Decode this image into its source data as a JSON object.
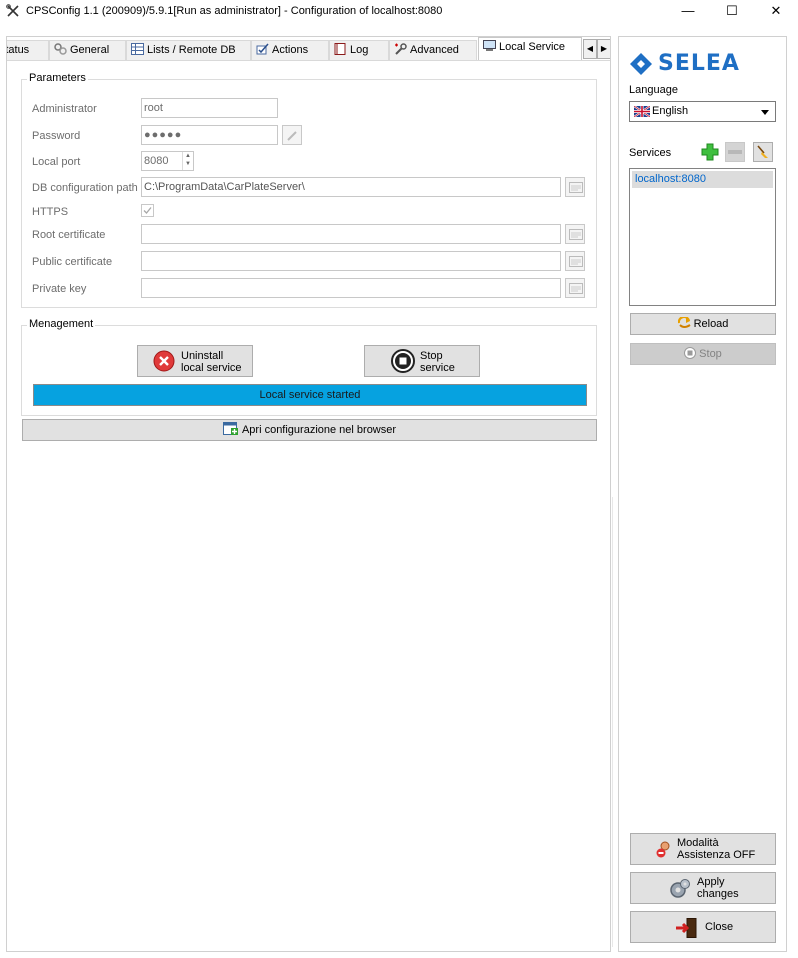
{
  "window": {
    "title": "CPSConfig 1.1 (200909)/5.9.1[Run as administrator] - Configuration of localhost:8080",
    "minimize": "—",
    "maximize": "☐",
    "close": "✕"
  },
  "tabs": [
    {
      "label": "Status",
      "icon": "status-icon"
    },
    {
      "label": "General",
      "icon": "gears-icon"
    },
    {
      "label": "Lists / Remote DB",
      "icon": "table-icon"
    },
    {
      "label": "Actions",
      "icon": "actions-icon"
    },
    {
      "label": "Log",
      "icon": "book-icon"
    },
    {
      "label": "Advanced",
      "icon": "wrench-icon"
    },
    {
      "label": "Local Service",
      "icon": "computer-icon",
      "active": true
    }
  ],
  "parameters": {
    "title": "Parameters",
    "administrator": {
      "label": "Administrator",
      "value": "root"
    },
    "password": {
      "label": "Password",
      "value": "●●●●●"
    },
    "local_port": {
      "label": "Local port",
      "value": "8080"
    },
    "db_path": {
      "label": "DB configuration path",
      "value": "C:\\ProgramData\\CarPlateServer\\"
    },
    "https": {
      "label": "HTTPS",
      "checked": true
    },
    "root_cert": {
      "label": "Root certificate",
      "value": ""
    },
    "public_cert": {
      "label": "Public certificate",
      "value": ""
    },
    "private_key": {
      "label": "Private key",
      "value": ""
    }
  },
  "management": {
    "title": "Menagement",
    "uninstall": {
      "line1": "Uninstall",
      "line2": "local service"
    },
    "stop": {
      "line1": "Stop",
      "line2": "service"
    },
    "status": "Local service started",
    "status_color": "#06a2e0"
  },
  "open_browser": "Apri configurazione nel browser",
  "sidebar": {
    "brand": "SELEA",
    "brand_color": "#1f6fc4",
    "language_label": "Language",
    "language_value": "English",
    "services_label": "Services",
    "services": [
      "localhost:8080"
    ],
    "reload": "Reload",
    "stop": "Stop",
    "assist": {
      "line1": "Modalità",
      "line2": "Assistenza OFF"
    },
    "apply": {
      "line1": "Apply",
      "line2": "changes"
    },
    "close": "Close"
  }
}
